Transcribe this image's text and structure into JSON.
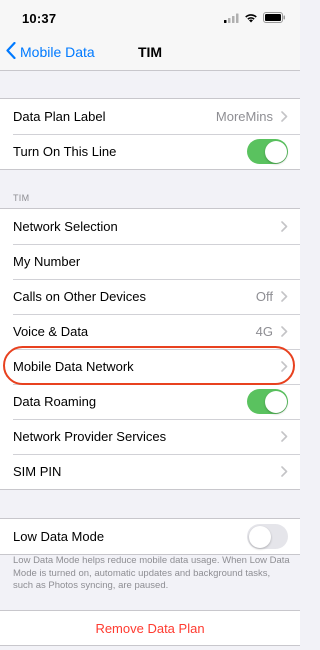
{
  "status_bar": {
    "time": "10:37"
  },
  "nav": {
    "back_label": "Mobile Data",
    "title": "TIM"
  },
  "group1": {
    "data_plan_label": "Data Plan Label",
    "data_plan_value": "MoreMins",
    "turn_on_line": "Turn On This Line",
    "turn_on_line_enabled": true
  },
  "section_tim": {
    "header": "TIM"
  },
  "group2": {
    "rows": [
      {
        "label": "Network Selection",
        "value": "",
        "control": "chevron"
      },
      {
        "label": "My Number",
        "value": "",
        "control": "none"
      },
      {
        "label": "Calls on Other Devices",
        "value": "Off",
        "control": "chevron"
      },
      {
        "label": "Voice & Data",
        "value": "4G",
        "control": "chevron"
      },
      {
        "label": "Mobile Data Network",
        "value": "",
        "control": "chevron",
        "highlighted": true
      },
      {
        "label": "Data Roaming",
        "value": "",
        "control": "toggle",
        "enabled": true
      },
      {
        "label": "Network Provider Services",
        "value": "",
        "control": "chevron"
      },
      {
        "label": "SIM PIN",
        "value": "",
        "control": "chevron"
      }
    ]
  },
  "group3": {
    "low_data_mode": "Low Data Mode",
    "low_data_mode_enabled": false,
    "footer": "Low Data Mode helps reduce mobile data usage. When Low Data Mode is turned on, automatic updates and background tasks, such as Photos syncing, are paused."
  },
  "remove": {
    "label": "Remove Data Plan"
  },
  "colors": {
    "accent": "#007aff",
    "toggle_on": "#5ac25f",
    "destructive": "#ff3b30",
    "highlight": "#e8411f"
  },
  "icons": [
    "back-chevron-icon",
    "chevron-right-icon",
    "signal-icon",
    "wifi-icon",
    "battery-icon"
  ]
}
